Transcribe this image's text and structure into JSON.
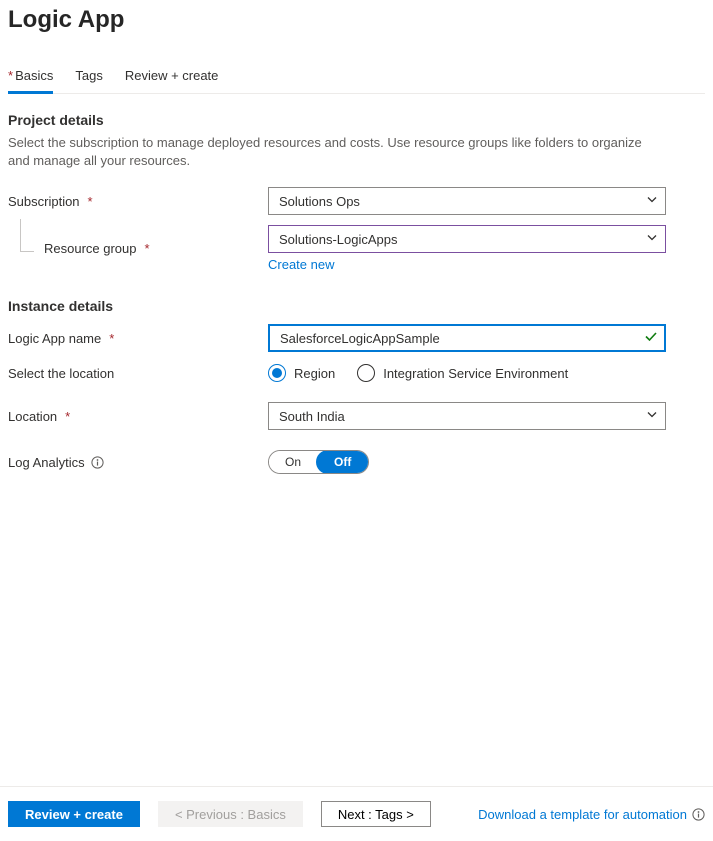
{
  "header": {
    "title": "Logic App"
  },
  "tabs": {
    "basics": "Basics",
    "tags": "Tags",
    "review": "Review + create"
  },
  "projectDetails": {
    "heading": "Project details",
    "description": "Select the subscription to manage deployed resources and costs. Use resource groups like folders to organize and manage all your resources.",
    "subscription": {
      "label": "Subscription",
      "value": "Solutions Ops"
    },
    "resourceGroup": {
      "label": "Resource group",
      "value": "Solutions-LogicApps",
      "createNew": "Create new"
    }
  },
  "instanceDetails": {
    "heading": "Instance details",
    "name": {
      "label": "Logic App name",
      "value": "SalesforceLogicAppSample"
    },
    "selectLocation": {
      "label": "Select the location",
      "region": "Region",
      "ise": "Integration Service Environment"
    },
    "location": {
      "label": "Location",
      "value": "South India"
    },
    "logAnalytics": {
      "label": "Log Analytics",
      "on": "On",
      "off": "Off"
    }
  },
  "footer": {
    "reviewCreate": "Review + create",
    "previous": "< Previous : Basics",
    "next": "Next : Tags >",
    "downloadTemplate": "Download a template for automation"
  }
}
